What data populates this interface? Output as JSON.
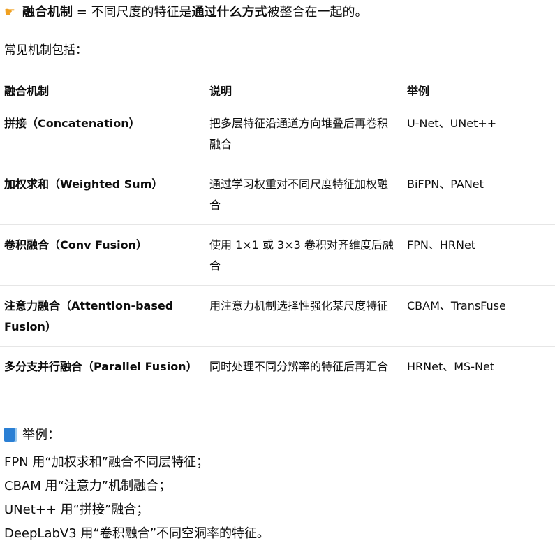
{
  "header": {
    "pointer_icon": "pointing-hand-icon",
    "term": "融合机制",
    "equals": " = 不同尺度的特征是",
    "emphasis": "通过什么方式",
    "rest": "被整合在一起的。"
  },
  "intro": "常见机制包括：",
  "table": {
    "headers": [
      "融合机制",
      "说明",
      "举例"
    ],
    "rows": [
      {
        "mechanism": "拼接（Concatenation）",
        "description": "把多层特征沿通道方向堆叠后再卷积融合",
        "example": "U-Net、UNet++"
      },
      {
        "mechanism": "加权求和（Weighted Sum）",
        "description": "通过学习权重对不同尺度特征加权融合",
        "example": "BiFPN、PANet"
      },
      {
        "mechanism": "卷积融合（Conv Fusion）",
        "description": "使用 1×1 或 3×3 卷积对齐维度后融合",
        "example": "FPN、HRNet"
      },
      {
        "mechanism": "注意力融合（Attention-based Fusion）",
        "description": "用注意力机制选择性强化某尺度特征",
        "example": "CBAM、TransFuse"
      },
      {
        "mechanism": "多分支并行融合（Parallel Fusion）",
        "description": "同时处理不同分辨率的特征后再汇合",
        "example": "HRNet、MS-Net"
      }
    ]
  },
  "examples": {
    "book_icon": "blue-book-icon",
    "title": "举例：",
    "items": [
      "FPN 用“加权求和”融合不同层特征；",
      "CBAM 用“注意力”机制融合；",
      "UNet++ 用“拼接”融合；",
      "DeepLabV3 用“卷积融合”不同空洞率的特征。"
    ]
  }
}
